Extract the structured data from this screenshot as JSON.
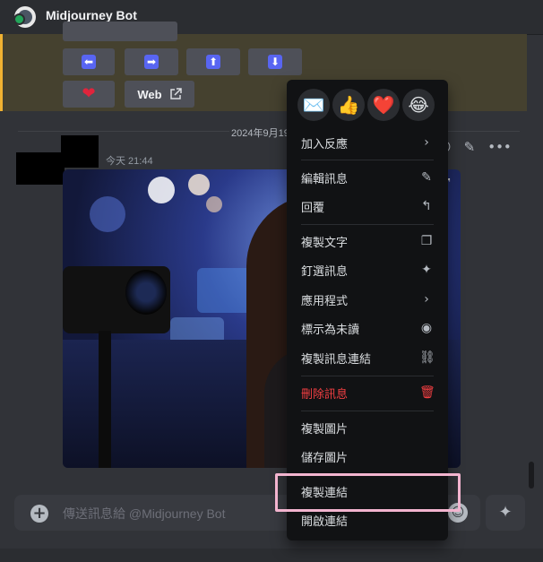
{
  "header": {
    "bot_name": "Midjourney Bot"
  },
  "buttons": {
    "arrows": [
      "⬅",
      "➡",
      "⬆",
      "⬇"
    ],
    "heart": "❤",
    "web_label": "Web",
    "web_icon": "external-link-icon"
  },
  "message": {
    "date_divider": "2024年9月19",
    "timestamp": "今天 21:44"
  },
  "context_menu": {
    "reactions": [
      "✉️",
      "👍",
      "❤️",
      "😂"
    ],
    "items": [
      {
        "label": "加入反應",
        "icon": "chevron-right-icon",
        "glyph": "›"
      },
      {
        "label": "編輯訊息",
        "icon": "pencil-icon",
        "glyph": "✎"
      },
      {
        "label": "回覆",
        "icon": "reply-icon",
        "glyph": "↰"
      },
      {
        "label": "複製文字",
        "icon": "copy-icon",
        "glyph": "❐"
      },
      {
        "label": "釘選訊息",
        "icon": "pin-icon",
        "glyph": "✦"
      },
      {
        "label": "應用程式",
        "icon": "chevron-right-icon",
        "glyph": "›"
      },
      {
        "label": "標示為未讀",
        "icon": "mark-unread-icon",
        "glyph": "◉"
      },
      {
        "label": "複製訊息連結",
        "icon": "link-icon",
        "glyph": "⛓"
      },
      {
        "label": "刪除訊息",
        "icon": "trash-icon",
        "glyph": "🗑",
        "danger": true
      },
      {
        "label": "複製圖片",
        "icon": "",
        "glyph": ""
      },
      {
        "label": "儲存圖片",
        "icon": "",
        "glyph": ""
      },
      {
        "label": "複製連結",
        "icon": "",
        "glyph": ""
      },
      {
        "label": "開啟連結",
        "icon": "",
        "glyph": ""
      }
    ]
  },
  "composer": {
    "placeholder": "傳送訊息給 @Midjourney Bot"
  },
  "colors": {
    "accent": "#5865f2",
    "danger": "#f23f42",
    "highlight": "#f3b4cf",
    "menu_bg": "#111214"
  }
}
